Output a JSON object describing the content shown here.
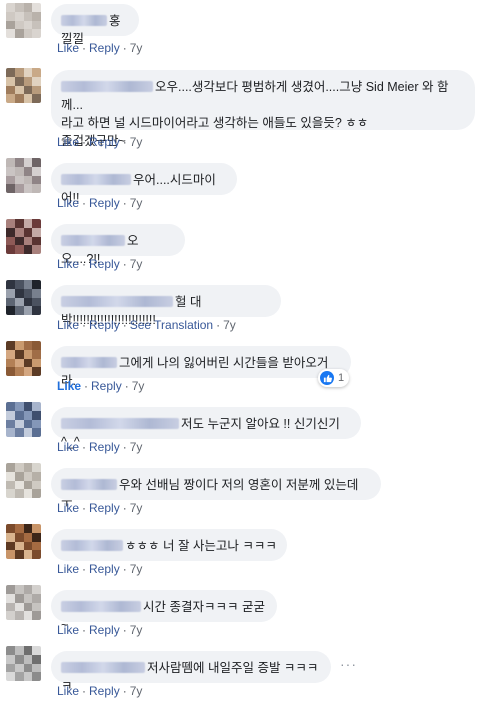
{
  "actions": {
    "like": "Like",
    "reply": "Reply",
    "see_translation": "See Translation",
    "separator": "·"
  },
  "comments": [
    {
      "text": "홍낄낄",
      "time": "7y"
    },
    {
      "text": "오우....생각보다 평범하게 생겼어....그냥 Sid Meier 와 함께...\n라고 하면 널 시드마이어라고 생각하는 애들도 있을듯? ㅎㅎ\n즐겁겠구만~",
      "time": "7y"
    },
    {
      "text": "우어....시드마이어!!",
      "time": "7y"
    },
    {
      "text": "오오....?!!",
      "time": "7y"
    },
    {
      "text": "헐 대박!!!!!!!!!!!!!!!!!!!!!!!!",
      "time": "7y"
    },
    {
      "text": "그에게 나의 잃어버린 시간들을 받아오거라.",
      "time": "7y",
      "reaction_count": "1"
    },
    {
      "text": "저도 누군지 알아요 !! 신기신기^_^",
      "time": "7y"
    },
    {
      "text": "우와 선배님 짱이다 저의 영혼이 저분께 있는데 ㅜ",
      "time": "7y"
    },
    {
      "text": "ㅎㅎㅎ 너 잘 사는고나 ㅋㅋㅋ",
      "time": "7y"
    },
    {
      "text": "시간 종결자ㅋㅋㅋ 굳굳~",
      "time": "7y"
    },
    {
      "text": "저사람뗌에 내일주일 증발 ㅋㅋㅋㅋ",
      "time": "7y",
      "more": "···"
    }
  ],
  "colors": {
    "link": "#385898",
    "liked": "#216fdb",
    "bubble": "#f0f2f5",
    "like_icon": "#1877f2"
  },
  "icons": {
    "reaction": "like-thumb-icon",
    "more": "more-options-icon"
  }
}
